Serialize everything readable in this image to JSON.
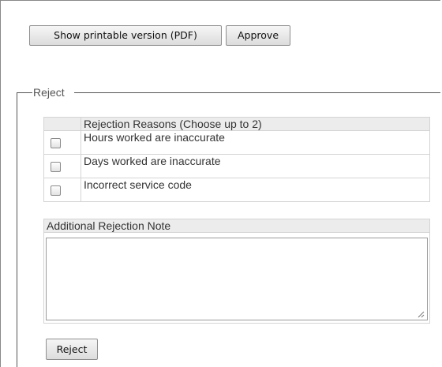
{
  "buttons": {
    "pdf_label": "Show printable version (PDF)",
    "approve_label": "Approve",
    "reject_label": "Reject"
  },
  "reject_section": {
    "legend": "Reject",
    "reasons_header": "Rejection Reasons (Choose up to 2)",
    "reasons": [
      {
        "label": "Hours worked are inaccurate",
        "checked": false
      },
      {
        "label": "Days worked are inaccurate",
        "checked": false
      },
      {
        "label": "Incorrect service code",
        "checked": false
      }
    ],
    "note_header": "Additional Rejection Note",
    "note_value": ""
  }
}
